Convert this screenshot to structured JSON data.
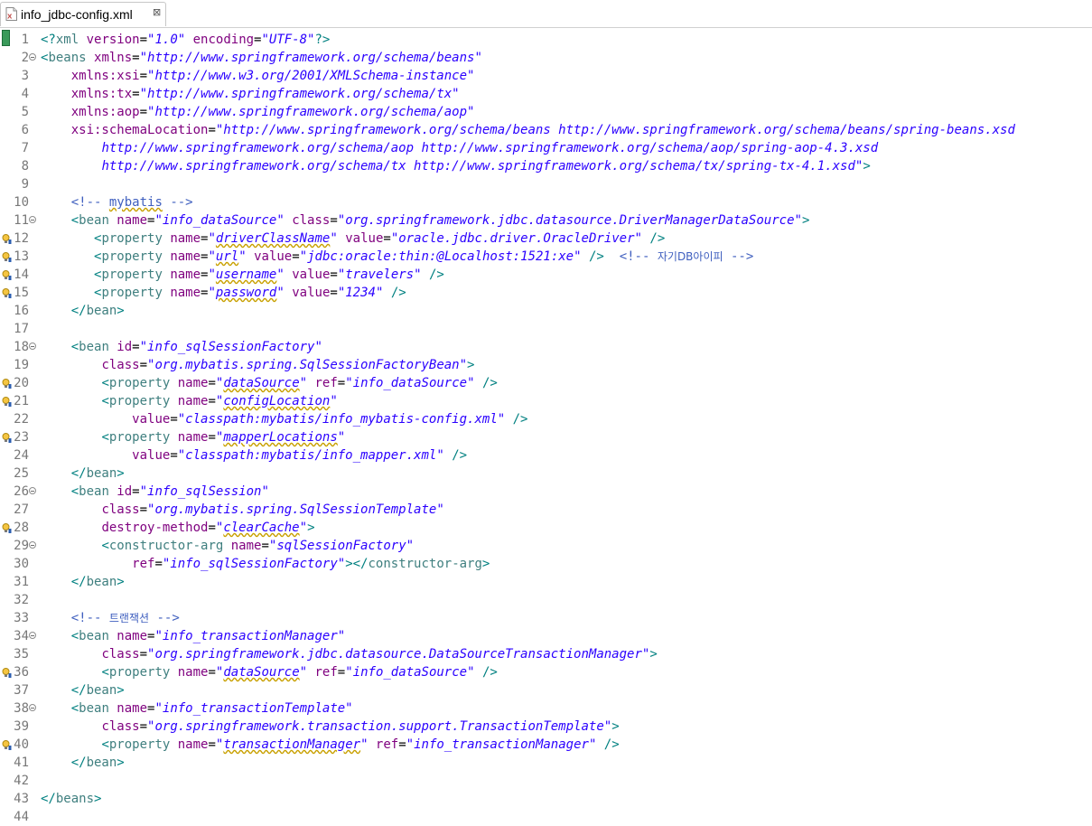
{
  "tab": {
    "title": "info_jdbc-config.xml",
    "close": "⊠"
  },
  "lines": [
    {
      "n": "1",
      "fold": false,
      "warn": false,
      "indent": 0,
      "tokens": [
        [
          "p",
          "<?"
        ],
        [
          "t",
          "xml"
        ],
        [
          "a",
          " version"
        ],
        [
          "e",
          "="
        ],
        [
          "v",
          "\"1.0\""
        ],
        [
          "a",
          " encoding"
        ],
        [
          "e",
          "="
        ],
        [
          "v",
          "\"UTF-8\""
        ],
        [
          "p",
          "?>"
        ]
      ]
    },
    {
      "n": "2",
      "fold": true,
      "warn": false,
      "indent": 0,
      "tokens": [
        [
          "p",
          "<"
        ],
        [
          "t",
          "beans"
        ],
        [
          "a",
          " xmlns"
        ],
        [
          "e",
          "="
        ],
        [
          "v",
          "\"http://www.springframework.org/schema/beans\""
        ]
      ]
    },
    {
      "n": "3",
      "fold": false,
      "warn": false,
      "indent": 4,
      "tokens": [
        [
          "a",
          "xmlns:xsi"
        ],
        [
          "e",
          "="
        ],
        [
          "v",
          "\"http://www.w3.org/2001/XMLSchema-instance\""
        ]
      ]
    },
    {
      "n": "4",
      "fold": false,
      "warn": false,
      "indent": 4,
      "tokens": [
        [
          "a",
          "xmlns:tx"
        ],
        [
          "e",
          "="
        ],
        [
          "v",
          "\"http://www.springframework.org/schema/tx\""
        ]
      ]
    },
    {
      "n": "5",
      "fold": false,
      "warn": false,
      "indent": 4,
      "tokens": [
        [
          "a",
          "xmlns:aop"
        ],
        [
          "e",
          "="
        ],
        [
          "v",
          "\"http://www.springframework.org/schema/aop\""
        ]
      ]
    },
    {
      "n": "6",
      "fold": false,
      "warn": false,
      "indent": 4,
      "tokens": [
        [
          "a",
          "xsi:schemaLocation"
        ],
        [
          "e",
          "="
        ],
        [
          "v",
          "\"http://www.springframework.org/schema/beans http://www.springframework.org/schema/beans/spring-beans.xsd"
        ]
      ]
    },
    {
      "n": "7",
      "fold": false,
      "warn": false,
      "indent": 8,
      "tokens": [
        [
          "v",
          "http://www.springframework.org/schema/aop http://www.springframework.org/schema/aop/spring-aop-4.3.xsd"
        ]
      ]
    },
    {
      "n": "8",
      "fold": false,
      "warn": false,
      "indent": 8,
      "tokens": [
        [
          "v",
          "http://www.springframework.org/schema/tx http://www.springframework.org/schema/tx/spring-tx-4.1.xsd\""
        ],
        [
          "p",
          ">"
        ]
      ]
    },
    {
      "n": "9",
      "fold": false,
      "warn": false,
      "indent": 0,
      "tokens": []
    },
    {
      "n": "10",
      "fold": false,
      "warn": false,
      "indent": 4,
      "tokens": [
        [
          "c",
          "<!-- "
        ],
        [
          "c sq",
          "mybatis"
        ],
        [
          "c",
          " -->"
        ]
      ]
    },
    {
      "n": "11",
      "fold": true,
      "warn": false,
      "indent": 4,
      "tokens": [
        [
          "p",
          "<"
        ],
        [
          "t",
          "bean"
        ],
        [
          "a",
          " name"
        ],
        [
          "e",
          "="
        ],
        [
          "v",
          "\"info_dataSource\""
        ],
        [
          "a",
          " class"
        ],
        [
          "e",
          "="
        ],
        [
          "v",
          "\"org.springframework.jdbc.datasource.DriverManagerDataSource\""
        ],
        [
          "p",
          ">"
        ]
      ]
    },
    {
      "n": "12",
      "fold": false,
      "warn": true,
      "indent": 7,
      "tokens": [
        [
          "p",
          "<"
        ],
        [
          "t",
          "property"
        ],
        [
          "a",
          " name"
        ],
        [
          "e",
          "="
        ],
        [
          "v",
          "\""
        ],
        [
          "v sq",
          "driverClassName"
        ],
        [
          "v",
          "\""
        ],
        [
          "a",
          " value"
        ],
        [
          "e",
          "="
        ],
        [
          "v",
          "\"oracle.jdbc.driver.OracleDriver\""
        ],
        [
          "p",
          " />"
        ]
      ]
    },
    {
      "n": "13",
      "fold": false,
      "warn": true,
      "indent": 7,
      "tokens": [
        [
          "p",
          "<"
        ],
        [
          "t",
          "property"
        ],
        [
          "a",
          " name"
        ],
        [
          "e",
          "="
        ],
        [
          "v",
          "\""
        ],
        [
          "v sq",
          "url"
        ],
        [
          "v",
          "\""
        ],
        [
          "a",
          " value"
        ],
        [
          "e",
          "="
        ],
        [
          "v",
          "\"jdbc:oracle:thin:@Localhost:1521:xe\""
        ],
        [
          "p",
          " />"
        ],
        [
          "c",
          "  <!-- "
        ],
        [
          "c ko",
          "자기DB아이피"
        ],
        [
          "c",
          " -->"
        ]
      ]
    },
    {
      "n": "14",
      "fold": false,
      "warn": true,
      "indent": 7,
      "tokens": [
        [
          "p",
          "<"
        ],
        [
          "t",
          "property"
        ],
        [
          "a",
          " name"
        ],
        [
          "e",
          "="
        ],
        [
          "v",
          "\""
        ],
        [
          "v sq",
          "username"
        ],
        [
          "v",
          "\""
        ],
        [
          "a",
          " value"
        ],
        [
          "e",
          "="
        ],
        [
          "v",
          "\"travelers\""
        ],
        [
          "p",
          " />"
        ]
      ]
    },
    {
      "n": "15",
      "fold": false,
      "warn": true,
      "indent": 7,
      "tokens": [
        [
          "p",
          "<"
        ],
        [
          "t",
          "property"
        ],
        [
          "a",
          " name"
        ],
        [
          "e",
          "="
        ],
        [
          "v",
          "\""
        ],
        [
          "v sq",
          "password"
        ],
        [
          "v",
          "\""
        ],
        [
          "a",
          " value"
        ],
        [
          "e",
          "="
        ],
        [
          "v",
          "\"1234\""
        ],
        [
          "p",
          " />"
        ]
      ]
    },
    {
      "n": "16",
      "fold": false,
      "warn": false,
      "indent": 4,
      "tokens": [
        [
          "p",
          "</"
        ],
        [
          "t",
          "bean"
        ],
        [
          "p",
          ">"
        ]
      ]
    },
    {
      "n": "17",
      "fold": false,
      "warn": false,
      "indent": 0,
      "tokens": []
    },
    {
      "n": "18",
      "fold": true,
      "warn": false,
      "indent": 4,
      "tokens": [
        [
          "p",
          "<"
        ],
        [
          "t",
          "bean"
        ],
        [
          "a",
          " id"
        ],
        [
          "e",
          "="
        ],
        [
          "v",
          "\"info_sqlSessionFactory\""
        ]
      ]
    },
    {
      "n": "19",
      "fold": false,
      "warn": false,
      "indent": 8,
      "tokens": [
        [
          "a",
          "class"
        ],
        [
          "e",
          "="
        ],
        [
          "v",
          "\"org.mybatis.spring.SqlSessionFactoryBean\""
        ],
        [
          "p",
          ">"
        ]
      ]
    },
    {
      "n": "20",
      "fold": false,
      "warn": true,
      "indent": 8,
      "tokens": [
        [
          "p",
          "<"
        ],
        [
          "t",
          "property"
        ],
        [
          "a",
          " name"
        ],
        [
          "e",
          "="
        ],
        [
          "v",
          "\""
        ],
        [
          "v sq",
          "dataSource"
        ],
        [
          "v",
          "\""
        ],
        [
          "a",
          " ref"
        ],
        [
          "e",
          "="
        ],
        [
          "v",
          "\"info_dataSource\""
        ],
        [
          "p",
          " />"
        ]
      ]
    },
    {
      "n": "21",
      "fold": false,
      "warn": true,
      "indent": 8,
      "tokens": [
        [
          "p",
          "<"
        ],
        [
          "t",
          "property"
        ],
        [
          "a",
          " name"
        ],
        [
          "e",
          "="
        ],
        [
          "v",
          "\""
        ],
        [
          "v sq",
          "configLocation"
        ],
        [
          "v",
          "\""
        ]
      ]
    },
    {
      "n": "22",
      "fold": false,
      "warn": false,
      "indent": 12,
      "tokens": [
        [
          "a",
          "value"
        ],
        [
          "e",
          "="
        ],
        [
          "v",
          "\"classpath:mybatis/info_mybatis-config.xml\""
        ],
        [
          "p",
          " />"
        ]
      ]
    },
    {
      "n": "23",
      "fold": false,
      "warn": true,
      "indent": 8,
      "tokens": [
        [
          "p",
          "<"
        ],
        [
          "t",
          "property"
        ],
        [
          "a",
          " name"
        ],
        [
          "e",
          "="
        ],
        [
          "v",
          "\""
        ],
        [
          "v sq",
          "mapperLocations"
        ],
        [
          "v",
          "\""
        ]
      ]
    },
    {
      "n": "24",
      "fold": false,
      "warn": false,
      "indent": 12,
      "tokens": [
        [
          "a",
          "value"
        ],
        [
          "e",
          "="
        ],
        [
          "v",
          "\"classpath:mybatis/info_mapper.xml\""
        ],
        [
          "p",
          " />"
        ]
      ]
    },
    {
      "n": "25",
      "fold": false,
      "warn": false,
      "indent": 4,
      "tokens": [
        [
          "p",
          "</"
        ],
        [
          "t",
          "bean"
        ],
        [
          "p",
          ">"
        ]
      ]
    },
    {
      "n": "26",
      "fold": true,
      "warn": false,
      "indent": 4,
      "tokens": [
        [
          "p",
          "<"
        ],
        [
          "t",
          "bean"
        ],
        [
          "a",
          " id"
        ],
        [
          "e",
          "="
        ],
        [
          "v",
          "\"info_sqlSession\""
        ]
      ]
    },
    {
      "n": "27",
      "fold": false,
      "warn": false,
      "indent": 8,
      "tokens": [
        [
          "a",
          "class"
        ],
        [
          "e",
          "="
        ],
        [
          "v",
          "\"org.mybatis.spring.SqlSessionTemplate\""
        ]
      ]
    },
    {
      "n": "28",
      "fold": false,
      "warn": true,
      "indent": 8,
      "tokens": [
        [
          "a",
          "destroy-method"
        ],
        [
          "e",
          "="
        ],
        [
          "v",
          "\""
        ],
        [
          "v sq",
          "clearCache"
        ],
        [
          "v",
          "\""
        ],
        [
          "p",
          ">"
        ]
      ]
    },
    {
      "n": "29",
      "fold": true,
      "warn": false,
      "indent": 8,
      "tokens": [
        [
          "p",
          "<"
        ],
        [
          "t",
          "constructor-arg"
        ],
        [
          "a",
          " name"
        ],
        [
          "e",
          "="
        ],
        [
          "v",
          "\"sqlSessionFactory\""
        ]
      ]
    },
    {
      "n": "30",
      "fold": false,
      "warn": false,
      "indent": 12,
      "tokens": [
        [
          "a",
          "ref"
        ],
        [
          "e",
          "="
        ],
        [
          "v",
          "\"info_sqlSessionFactory\""
        ],
        [
          "p",
          "></"
        ],
        [
          "t",
          "constructor-arg"
        ],
        [
          "p",
          ">"
        ]
      ]
    },
    {
      "n": "31",
      "fold": false,
      "warn": false,
      "indent": 4,
      "tokens": [
        [
          "p",
          "</"
        ],
        [
          "t",
          "bean"
        ],
        [
          "p",
          ">"
        ]
      ]
    },
    {
      "n": "32",
      "fold": false,
      "warn": false,
      "indent": 0,
      "tokens": []
    },
    {
      "n": "33",
      "fold": false,
      "warn": false,
      "indent": 4,
      "tokens": [
        [
          "c",
          "<!-- "
        ],
        [
          "c ko",
          "트랜잭션"
        ],
        [
          "c",
          " -->"
        ]
      ]
    },
    {
      "n": "34",
      "fold": true,
      "warn": false,
      "indent": 4,
      "tokens": [
        [
          "p",
          "<"
        ],
        [
          "t",
          "bean"
        ],
        [
          "a",
          " name"
        ],
        [
          "e",
          "="
        ],
        [
          "v",
          "\"info_transactionManager\""
        ]
      ]
    },
    {
      "n": "35",
      "fold": false,
      "warn": false,
      "indent": 8,
      "tokens": [
        [
          "a",
          "class"
        ],
        [
          "e",
          "="
        ],
        [
          "v",
          "\"org.springframework.jdbc.datasource.DataSourceTransactionManager\""
        ],
        [
          "p",
          ">"
        ]
      ]
    },
    {
      "n": "36",
      "fold": false,
      "warn": true,
      "indent": 8,
      "tokens": [
        [
          "p",
          "<"
        ],
        [
          "t",
          "property"
        ],
        [
          "a",
          " name"
        ],
        [
          "e",
          "="
        ],
        [
          "v",
          "\""
        ],
        [
          "v sq",
          "dataSource"
        ],
        [
          "v",
          "\""
        ],
        [
          "a",
          " ref"
        ],
        [
          "e",
          "="
        ],
        [
          "v",
          "\"info_dataSource\""
        ],
        [
          "p",
          " />"
        ]
      ]
    },
    {
      "n": "37",
      "fold": false,
      "warn": false,
      "indent": 4,
      "tokens": [
        [
          "p",
          "</"
        ],
        [
          "t",
          "bean"
        ],
        [
          "p",
          ">"
        ]
      ]
    },
    {
      "n": "38",
      "fold": true,
      "warn": false,
      "indent": 4,
      "tokens": [
        [
          "p",
          "<"
        ],
        [
          "t",
          "bean"
        ],
        [
          "a",
          " name"
        ],
        [
          "e",
          "="
        ],
        [
          "v",
          "\"info_transactionTemplate\""
        ]
      ]
    },
    {
      "n": "39",
      "fold": false,
      "warn": false,
      "indent": 8,
      "tokens": [
        [
          "a",
          "class"
        ],
        [
          "e",
          "="
        ],
        [
          "v",
          "\"org.springframework.transaction.support.TransactionTemplate\""
        ],
        [
          "p",
          ">"
        ]
      ]
    },
    {
      "n": "40",
      "fold": false,
      "warn": true,
      "indent": 8,
      "tokens": [
        [
          "p",
          "<"
        ],
        [
          "t",
          "property"
        ],
        [
          "a",
          " name"
        ],
        [
          "e",
          "="
        ],
        [
          "v",
          "\""
        ],
        [
          "v sq",
          "transactionManager"
        ],
        [
          "v",
          "\""
        ],
        [
          "a",
          " ref"
        ],
        [
          "e",
          "="
        ],
        [
          "v",
          "\"info_transactionManager\""
        ],
        [
          "p",
          " />"
        ]
      ]
    },
    {
      "n": "41",
      "fold": false,
      "warn": false,
      "indent": 4,
      "tokens": [
        [
          "p",
          "</"
        ],
        [
          "t",
          "bean"
        ],
        [
          "p",
          ">"
        ]
      ]
    },
    {
      "n": "42",
      "fold": false,
      "warn": false,
      "indent": 0,
      "tokens": []
    },
    {
      "n": "43",
      "fold": false,
      "warn": false,
      "indent": 0,
      "tokens": [
        [
          "p",
          "</"
        ],
        [
          "t",
          "beans"
        ],
        [
          "p",
          ">"
        ]
      ]
    },
    {
      "n": "44",
      "fold": false,
      "warn": false,
      "indent": 0,
      "tokens": []
    }
  ]
}
